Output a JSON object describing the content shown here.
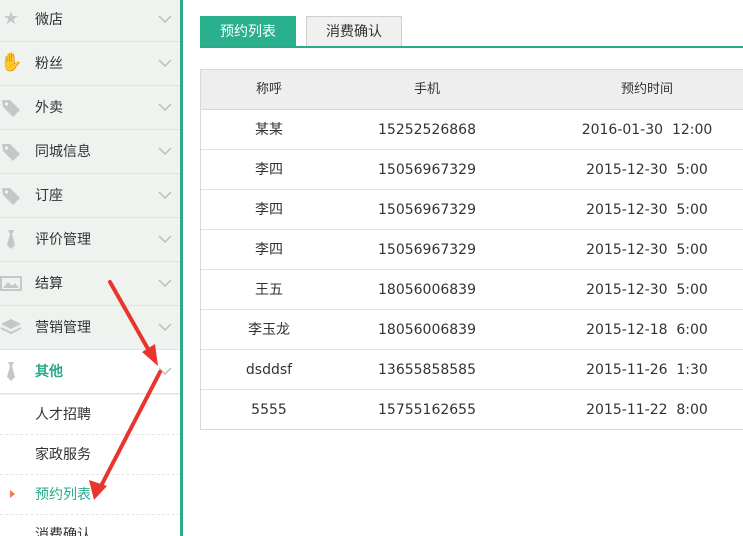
{
  "sidebar": {
    "items": [
      {
        "label": "微店",
        "icon": "star-icon"
      },
      {
        "label": "粉丝",
        "icon": "hand-icon"
      },
      {
        "label": "外卖",
        "icon": "tag-icon"
      },
      {
        "label": "同城信息",
        "icon": "tag-icon"
      },
      {
        "label": "订座",
        "icon": "tag-icon"
      },
      {
        "label": "评价管理",
        "icon": "tie-icon"
      },
      {
        "label": "结算",
        "icon": "image-icon"
      },
      {
        "label": "营销管理",
        "icon": "layers-icon"
      },
      {
        "label": "其他",
        "icon": "tie-icon"
      }
    ],
    "submenu": [
      {
        "label": "人才招聘"
      },
      {
        "label": "家政服务"
      },
      {
        "label": "预约列表"
      },
      {
        "label": "消费确认"
      }
    ]
  },
  "tabs": [
    {
      "label": "预约列表"
    },
    {
      "label": "消费确认"
    }
  ],
  "table": {
    "headers": [
      "称呼",
      "手机",
      "预约时间"
    ],
    "rows": [
      {
        "name": "某某",
        "phone": "15252526868",
        "time": "2016-01-30  12:00"
      },
      {
        "name": "李四",
        "phone": "15056967329",
        "time": "2015-12-30  5:00"
      },
      {
        "name": "李四",
        "phone": "15056967329",
        "time": "2015-12-30  5:00"
      },
      {
        "name": "李四",
        "phone": "15056967329",
        "time": "2015-12-30  5:00"
      },
      {
        "name": "王五",
        "phone": "18056006839",
        "time": "2015-12-30  5:00"
      },
      {
        "name": "李玉龙",
        "phone": "18056006839",
        "time": "2015-12-18  6:00"
      },
      {
        "name": "dsddsf",
        "phone": "13655858585",
        "time": "2015-11-26  1:30"
      },
      {
        "name": "5555",
        "phone": "15755162655",
        "time": "2015-11-22  8:00"
      }
    ]
  },
  "colors": {
    "accent": "#2aaa8a",
    "arrow": "#e8352e",
    "marker": "#f07a50"
  }
}
